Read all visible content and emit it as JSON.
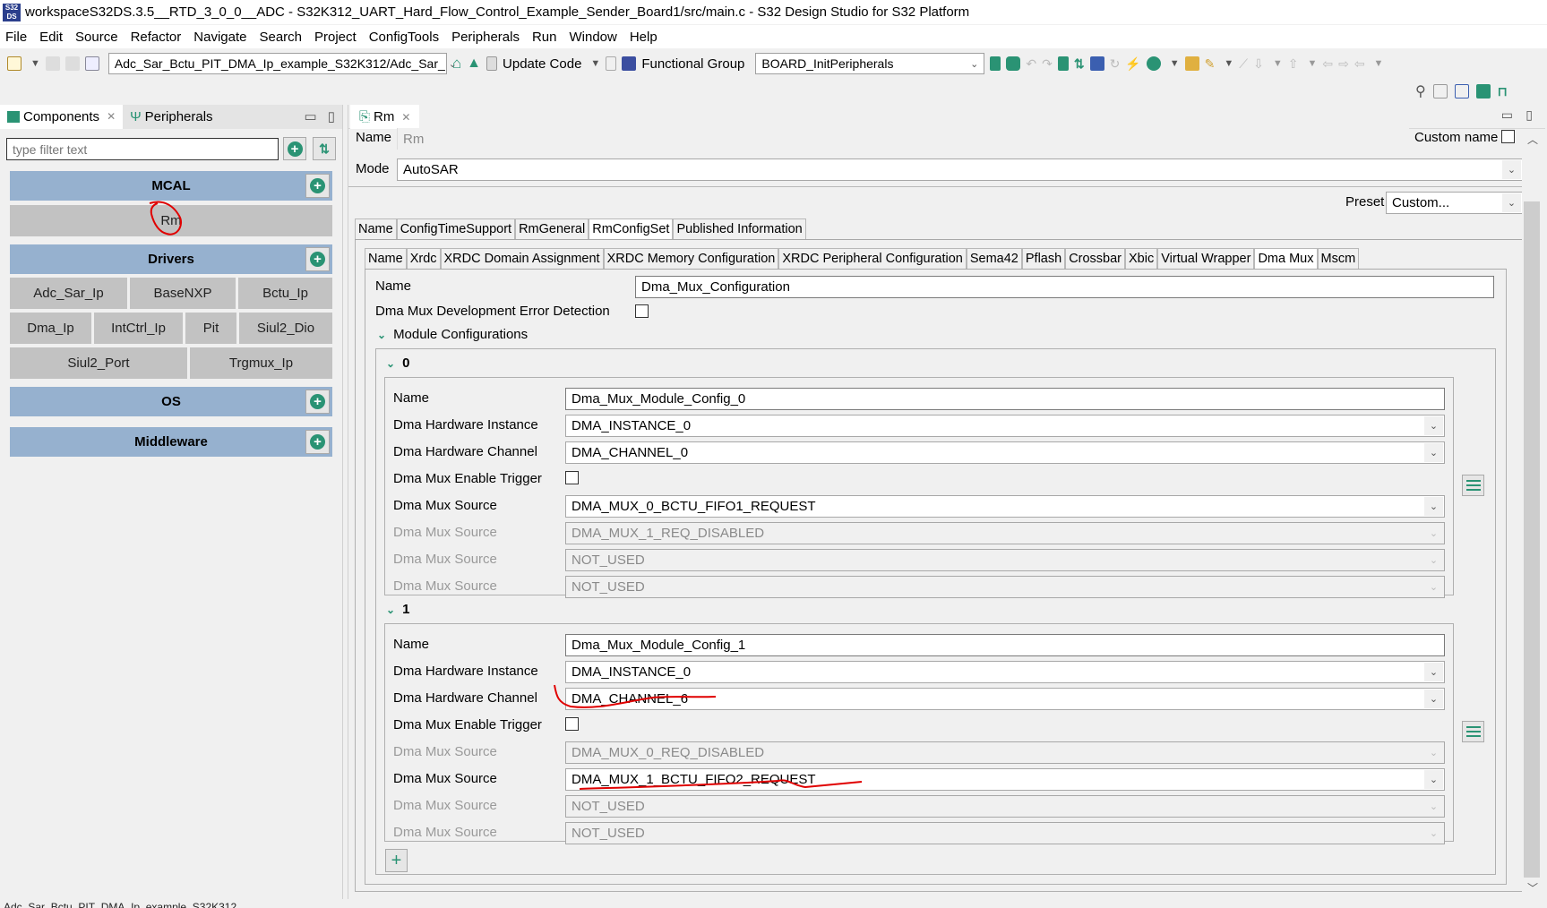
{
  "window": {
    "title": "workspaceS32DS.3.5__RTD_3_0_0__ADC - S32K312_UART_Hard_Flow_Control_Example_Sender_Board1/src/main.c - S32 Design Studio for S32 Platform"
  },
  "menu": [
    "File",
    "Edit",
    "Source",
    "Refactor",
    "Navigate",
    "Search",
    "Project",
    "ConfigTools",
    "Peripherals",
    "Run",
    "Window",
    "Help"
  ],
  "toolbar": {
    "project_combo": "Adc_Sar_Bctu_PIT_DMA_Ip_example_S32K312/Adc_Sar_",
    "update_code": "Update Code",
    "functional_group_label": "Functional Group",
    "functional_group_value": "BOARD_InitPeripherals"
  },
  "left": {
    "tabs": [
      "Components",
      "Peripherals"
    ],
    "filter_placeholder": "type filter text",
    "categories": {
      "mcal": {
        "title": "MCAL",
        "items": [
          "Rm"
        ]
      },
      "drivers": {
        "title": "Drivers",
        "items": [
          "Adc_Sar_Ip",
          "BaseNXP",
          "Bctu_Ip",
          "Dma_Ip",
          "IntCtrl_Ip",
          "Pit",
          "Siul2_Dio",
          "Siul2_Port",
          "Trgmux_Ip"
        ]
      },
      "os": {
        "title": "OS"
      },
      "middleware": {
        "title": "Middleware"
      }
    }
  },
  "editor": {
    "tab": "Rm",
    "name_label": "Name",
    "name_value": "Rm",
    "custom_name_label": "Custom name",
    "mode_label": "Mode",
    "mode_value": "AutoSAR",
    "preset_label": "Preset",
    "preset_value": "Custom...",
    "outer_tabs": [
      "Name",
      "ConfigTimeSupport",
      "RmGeneral",
      "RmConfigSet",
      "Published Information"
    ],
    "outer_selected": "RmConfigSet",
    "inner_tabs": [
      "Name",
      "Xrdc",
      "XRDC Domain Assignment",
      "XRDC Memory Configuration",
      "XRDC Peripheral Configuration",
      "Sema42",
      "Pflash",
      "Crossbar",
      "Xbic",
      "Virtual Wrapper",
      "Dma Mux",
      "Mscm"
    ],
    "inner_selected": "Dma Mux",
    "config_name_label": "Name",
    "config_name_value": "Dma_Mux_Configuration",
    "dev_error_label": "Dma Mux Development Error Detection",
    "dev_error_checked": false,
    "module_configs_label": "Module Configurations",
    "modules": [
      {
        "index": "0",
        "rows": [
          {
            "label": "Name",
            "value": "Dma_Mux_Module_Config_0",
            "type": "text",
            "enabled": true
          },
          {
            "label": "Dma Hardware Instance",
            "value": "DMA_INSTANCE_0",
            "type": "select",
            "enabled": true
          },
          {
            "label": "Dma Hardware Channel",
            "value": "DMA_CHANNEL_0",
            "type": "select",
            "enabled": true
          },
          {
            "label": "Dma Mux Enable Trigger",
            "value": false,
            "type": "checkbox",
            "enabled": true
          },
          {
            "label": "Dma Mux Source",
            "value": "DMA_MUX_0_BCTU_FIFO1_REQUEST",
            "type": "select",
            "enabled": true
          },
          {
            "label": "Dma Mux Source",
            "value": "DMA_MUX_1_REQ_DISABLED",
            "type": "select",
            "enabled": false
          },
          {
            "label": "Dma Mux Source",
            "value": "NOT_USED",
            "type": "select",
            "enabled": false
          },
          {
            "label": "Dma Mux Source",
            "value": "NOT_USED",
            "type": "select",
            "enabled": false
          }
        ]
      },
      {
        "index": "1",
        "rows": [
          {
            "label": "Name",
            "value": "Dma_Mux_Module_Config_1",
            "type": "text",
            "enabled": true
          },
          {
            "label": "Dma Hardware Instance",
            "value": "DMA_INSTANCE_0",
            "type": "select",
            "enabled": true
          },
          {
            "label": "Dma Hardware Channel",
            "value": "DMA_CHANNEL_6",
            "type": "select",
            "enabled": true
          },
          {
            "label": "Dma Mux Enable Trigger",
            "value": false,
            "type": "checkbox",
            "enabled": true
          },
          {
            "label": "Dma Mux Source",
            "value": "DMA_MUX_0_REQ_DISABLED",
            "type": "select",
            "enabled": false
          },
          {
            "label": "Dma Mux Source",
            "value": "DMA_MUX_1_BCTU_FIFO2_REQUEST",
            "type": "select",
            "enabled": true
          },
          {
            "label": "Dma Mux Source",
            "value": "NOT_USED",
            "type": "select",
            "enabled": false
          },
          {
            "label": "Dma Mux Source",
            "value": "NOT_USED",
            "type": "select",
            "enabled": false
          }
        ]
      }
    ]
  },
  "status": {
    "text": "Adc_Sar_Bctu_PIT_DMA_Ip_example_S32K312"
  },
  "colors": {
    "accent": "#2a9374",
    "category_header": "#96b1cf",
    "component_tile": "#c2c2c2",
    "annotation": "#e00000"
  }
}
